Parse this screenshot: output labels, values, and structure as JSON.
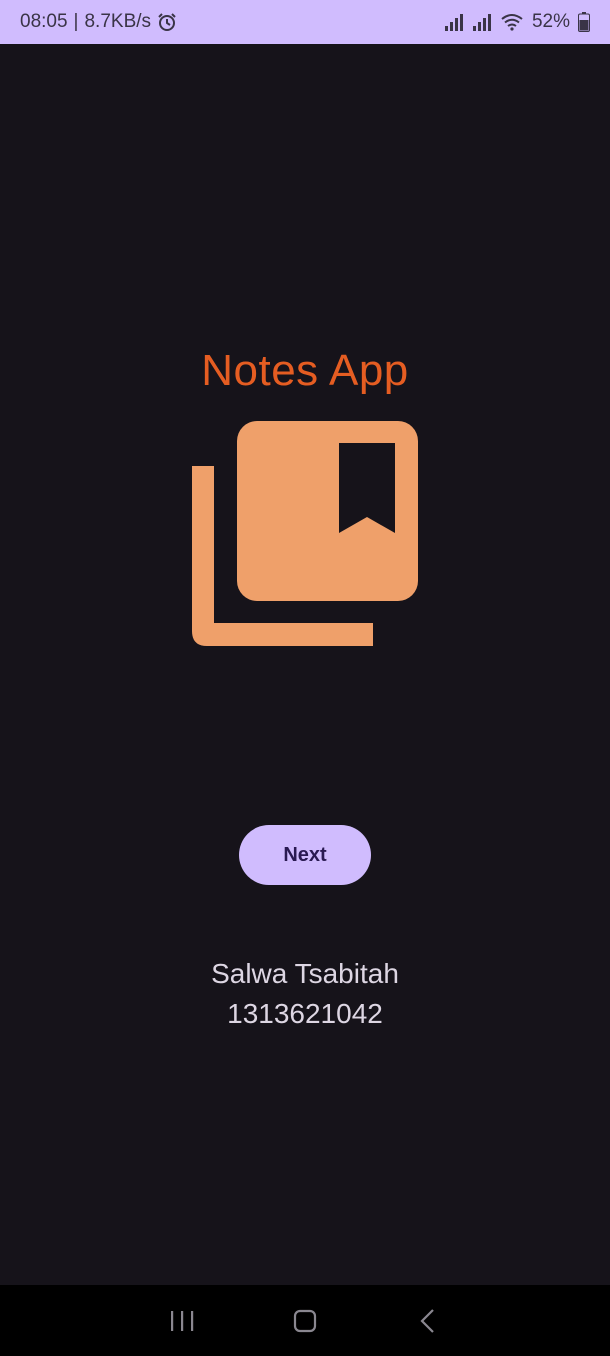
{
  "status_bar": {
    "time": "08:05",
    "separator": "|",
    "network_speed": "8.7KB/s",
    "battery": "52%",
    "icons": [
      "alarm-icon",
      "signal-icon",
      "signal-icon",
      "wifi-icon",
      "battery-icon"
    ],
    "background": "#d0bcfe"
  },
  "main": {
    "title": "Notes App",
    "logo_icon": "collections-bookmark-icon",
    "next_label": "Next",
    "author_name": "Salwa Tsabitah",
    "author_id": "1313621042"
  },
  "nav_bar": {
    "icons": [
      "recent-apps-icon",
      "home-icon",
      "back-icon"
    ]
  },
  "colors": {
    "background": "#16131a",
    "title": "#e55d22",
    "logo": "#efa06a",
    "button": "#d0bcfe",
    "button_text": "#2a1a52",
    "text": "#ddd6e3"
  }
}
